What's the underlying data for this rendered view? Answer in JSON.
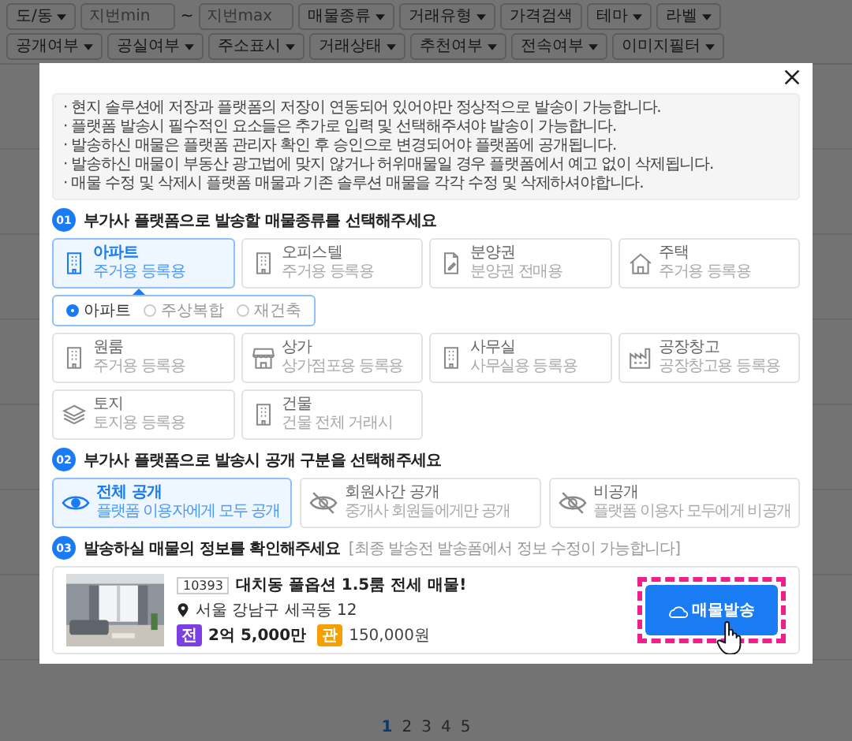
{
  "filters": [
    [
      {
        "kind": "dropdown",
        "label": "도/동"
      },
      {
        "kind": "input",
        "placeholder": "지번min"
      },
      {
        "kind": "text",
        "label": "~"
      },
      {
        "kind": "input",
        "placeholder": "지번max"
      },
      {
        "kind": "dropdown",
        "label": "매물종류"
      },
      {
        "kind": "dropdown",
        "label": "거래유형"
      },
      {
        "kind": "button",
        "label": "가격검색"
      },
      {
        "kind": "dropdown",
        "label": "테마"
      },
      {
        "kind": "dropdown",
        "label": "라벨"
      }
    ],
    [
      {
        "kind": "dropdown",
        "label": "공개여부"
      },
      {
        "kind": "dropdown",
        "label": "공실여부"
      },
      {
        "kind": "dropdown",
        "label": "주소표시"
      },
      {
        "kind": "dropdown",
        "label": "거래상태"
      },
      {
        "kind": "dropdown",
        "label": "추천여부"
      },
      {
        "kind": "dropdown",
        "label": "전속여부"
      },
      {
        "kind": "dropdown",
        "label": "이미지필터"
      }
    ]
  ],
  "modal": {
    "notes": [
      "· 현지 솔루션에 저장과 플랫폼의 저장이 연동되어 있어야만 정상적으로 발송이 가능합니다.",
      "· 플랫폼 발송시 필수적인 요소들은 추가로 입력 및 선택해주셔야 발송이 가능합니다.",
      "· 발송하신 매물은 플랫폼 관리자 확인 후 승인으로 변경되어야 플랫폼에 공개됩니다.",
      "· 발송하신 매물이 부동산 광고법에 맞지 않거나 허위매물일 경우 플랫폼에서 예고 없이 삭제됩니다.",
      "· 매물 수정 및 삭제시 플랫폼 매물과 기존 솔루션 매물을 각각 수정 및 삭제하셔야합니다."
    ],
    "property_type": {
      "number": "01",
      "heading": "부가사 플랫폼으로 발송할 매물종류를 선택해주세요",
      "types": [
        {
          "title": "아파트",
          "subtitle": "주거용 등록용",
          "selected": true
        },
        {
          "title": "오피스텔",
          "subtitle": "주거용 등록용",
          "selected": false
        },
        {
          "title": "분양권",
          "subtitle": "분양권 전매용",
          "selected": false
        },
        {
          "title": "주택",
          "subtitle": "주거용 등록용",
          "selected": false
        },
        {
          "title": "원룸",
          "subtitle": "주거용 등록용",
          "selected": false
        },
        {
          "title": "상가",
          "subtitle": "상가점포용 등록용",
          "selected": false
        },
        {
          "title": "사무실",
          "subtitle": "사무실용 등록용",
          "selected": false
        },
        {
          "title": "공장창고",
          "subtitle": "공장창고용 등록용",
          "selected": false
        },
        {
          "title": "토지",
          "subtitle": "토지용 등록용",
          "selected": false
        },
        {
          "title": "건물",
          "subtitle": "건물 전체 거래시",
          "selected": false
        }
      ],
      "subtypes": [
        {
          "label": "아파트",
          "selected": true
        },
        {
          "label": "주상복합",
          "selected": false
        },
        {
          "label": "재건축",
          "selected": false
        }
      ]
    },
    "disclosure": {
      "number": "02",
      "heading": "부가사 플랫폼으로 발송시 공개 구분을 선택해주세요",
      "options": [
        {
          "title": "전체 공개",
          "subtitle": "플랫폼 이용자에게 모두 공개",
          "selected": true
        },
        {
          "title": "회원사간 공개",
          "subtitle": "중개사 회원들에게만 공개",
          "selected": false
        },
        {
          "title": "비공개",
          "subtitle": "플랫폼 이용자 모두에게 비공개",
          "selected": false
        }
      ]
    },
    "listing": {
      "number": "03",
      "heading": "발송하실 매물의 정보를 확인해주세요",
      "hint": "[최종 발송전 발송폼에서 정보 수정이 가능합니다]",
      "code": "10393",
      "title": "대치동 풀옵션 1.5룸 전세 매물!",
      "address": "서울 강남구 세곡동 12",
      "prices": [
        {
          "badge": "전",
          "amount": "2억 5,000만",
          "color": "#7b3fe4"
        },
        {
          "badge": "관",
          "amount": "150,000원",
          "color": "#f5a000"
        }
      ],
      "send_button": "매물발송"
    }
  },
  "pagination": [
    {
      "label": "1",
      "selected": true
    },
    {
      "label": "2",
      "selected": false
    },
    {
      "label": "3",
      "selected": false
    },
    {
      "label": "4",
      "selected": false
    },
    {
      "label": "5",
      "selected": false
    }
  ]
}
